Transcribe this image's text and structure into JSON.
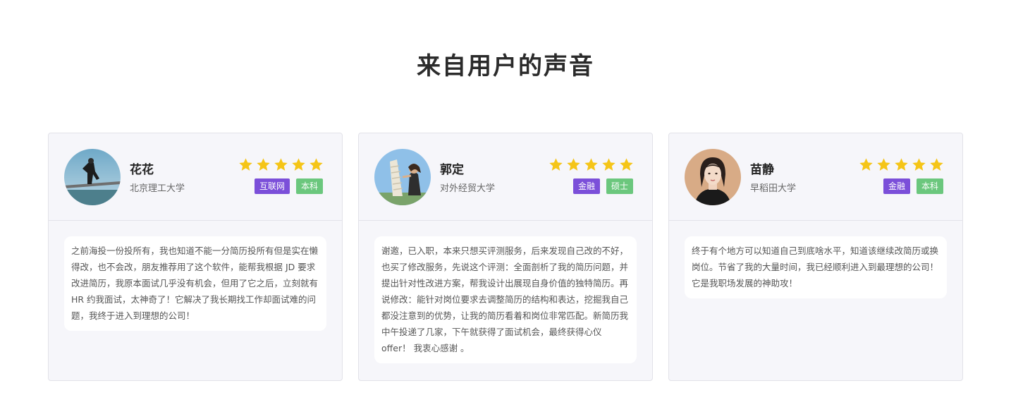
{
  "section": {
    "title": "来自用户的声音"
  },
  "colors": {
    "star": "#f5c518",
    "tag_industry": "#7b4fd9",
    "tag_degree": "#6bc77d",
    "card_bg": "#f6f6fa"
  },
  "testimonials": [
    {
      "name": "花花",
      "school": "北京理工大学",
      "rating": 5,
      "tags": [
        "互联网",
        "本科"
      ],
      "comment": "之前海投一份投所有，我也知道不能一分简历投所有但是实在懒得改，也不会改，朋友推荐用了这个软件，能帮我根据 JD 要求改进简历，我原本面试几乎没有机会，但用了它之后，立刻就有 HR 约我面试，太神奇了！它解决了我长期找工作却面试难的问题，我终于进入到理想的公司！"
    },
    {
      "name": "郭定",
      "school": "对外经贸大学",
      "rating": 5,
      "tags": [
        "金融",
        "硕士"
      ],
      "comment": "谢邀，已入职，本来只想买评测服务，后来发现自己改的不好，也买了修改服务，先说这个评测：全面剖析了我的简历问题，并提出针对性改进方案，帮我设计出展现自身价值的独特简历。再说修改：能针对岗位要求去调整简历的结构和表达，挖掘我自己都没注意到的优势，让我的简历看着和岗位非常匹配。新简历我中午投递了几家，下午就获得了面试机会，最终获得心仪 offer！ 我衷心感谢 。"
    },
    {
      "name": "苗静",
      "school": "早稻田大学",
      "rating": 5,
      "tags": [
        "金融",
        "本科"
      ],
      "comment": "终于有个地方可以知道自己到底啥水平，知道该继续改简历或换岗位。节省了我的大量时间，我已经顺利进入到最理想的公司！它是我职场发展的神助攻！"
    }
  ]
}
